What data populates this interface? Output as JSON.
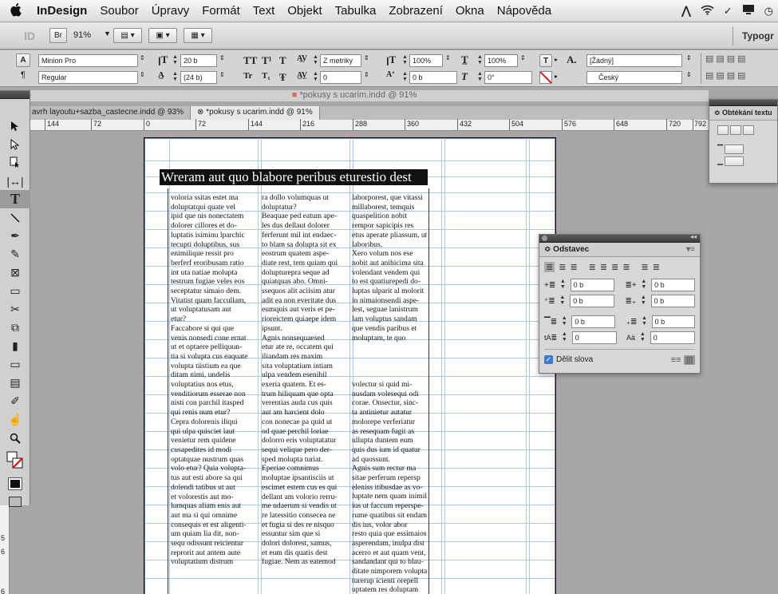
{
  "menubar": {
    "app_name": "InDesign",
    "items": [
      "Soubor",
      "Úpravy",
      "Formát",
      "Text",
      "Objekt",
      "Tabulka",
      "Zobrazení",
      "Okna",
      "Nápověda"
    ]
  },
  "appbar": {
    "id_logo": "ID",
    "br_button": "Br",
    "zoom": "91%",
    "workspace": "Typogr"
  },
  "control": {
    "font_family": "Minion Pro",
    "font_style": "Regular",
    "font_size": "20 b",
    "leading": "(24 b)",
    "kerning": "Z metriky",
    "tracking": "0",
    "vscale": "100%",
    "hscale": "100%",
    "baseline": "0 b",
    "skew": "0°",
    "char_style": "[Žádný]",
    "language": "Český",
    "glyphs_tt": "TT",
    "glyphs_t1": "T¹",
    "glyphs_tr": "Tr",
    "glyphs_t2": "T₁"
  },
  "window": {
    "title": "*pokusy s ucarim.indd @ 91%"
  },
  "tabs": [
    {
      "label": "avrh layoutu+sazba_castecne.indd @ 93%"
    },
    {
      "label": "*pokusy s ucarim.indd @ 91%"
    }
  ],
  "ruler": {
    "ticks": [
      "144",
      "72",
      "0",
      "72",
      "144",
      "216",
      "288",
      "360",
      "432",
      "504",
      "576",
      "648",
      "720",
      "792"
    ],
    "vticks": [
      "4",
      "5",
      "6",
      "6"
    ]
  },
  "document": {
    "heading": "Wreram aut quo blabore peribus eturestio dest",
    "col1": [
      "voloria ssitas estet ma",
      "doluptatqui quate vel",
      "ipid que nis nonectatem",
      "dolorer cillores et do-",
      "luptatis isiminu lparchic",
      "tecupti doluptibus, sus",
      "enimilique ressit pro",
      "berferf eroribusam ratio",
      "int uta natiae molupta",
      "testrum fugiae veles eos",
      "seceptatur simaio dem.",
      "Vitatist quam faccullam,",
      "ut voluptatusam aut",
      "etur?",
      "Faccabore si qui que",
      "venis nonsedi cone ernat",
      "ut et optaere pelliquun-",
      "tia si volupta cus eaquate",
      "volupta tiistium ea que",
      "ditam nimi, undelis",
      "voluptatius nos etus,",
      "venditiorum esserae non",
      "nisti con parchil itasped",
      "qui renis num etur?",
      "Cepra dolorenis iliqui",
      "qui ulpa quisciet laut",
      "venietur rem quidene",
      "cusapedites id modi",
      "optatquae nustrum quas",
      "volo etur? Quia volupta-",
      "tus aut esti abore sa qui",
      "dolendi tatibus ut aut",
      "et volorestis aut mo-",
      "lumquas aliam enis aut",
      "aut ma si qui omnime",
      "consequis et est aligenti-",
      "um quiam lia dit, non-",
      "sequ odissunt reicientur",
      "reprorit aut antem aute",
      "voluptatium distrum"
    ],
    "col2": [
      "ra dollo volumquas ut",
      "doluptatur?",
      "Beaquae ped eatum ape-",
      "les dus dellaut dolorer",
      "ferferunt mil int endaec-",
      "to blam sa dolupta sit ex",
      "eostrum quatem aspe-",
      "diate rest, tem quiam qui",
      "dolupturepra seque ad",
      "quiatquas abo. Omni-",
      "ssequos alit aciisim atur",
      "adit ea non everitate dus",
      "eumquis aut veris et pe-",
      "rioreictem quiaepe idem",
      "ipsunt.",
      "Agnis nonsequaesed",
      "etur ate re, occatem qui",
      "iliandam res maxim",
      "sita voluptatium intiam",
      "ulpa vendem esenihil",
      "exeria quatem. Et es-",
      "trum hiliquam que opta",
      "verentias auda cus quis",
      "aut am harcient dolo",
      "con nonecae pa quid ut",
      "od quae perchil loriae",
      "dolorro eris voluptatatur",
      "sequi velique pero der-",
      "sped molupta turiat.",
      "Eperiae comnimus",
      "moluptae ipsantisciis ut",
      "escimet estem cus es qui",
      "dellant am volorio rerru-",
      "me ndaerum si vendis ut",
      "re latessitio consecea ne",
      "et fugia si des re nisquo",
      "essuntur sim que si",
      "dolori dolorest, samus,",
      "et eum dis quatis dest",
      "fugiae. Nem as eatemod"
    ],
    "col3a": [
      "laborporest, que vitassi",
      "millaborest, temquis",
      "quaspelition nobit",
      "rempor sapicipis res",
      "etus aperate pliassum, ut",
      "laboribus.",
      "Xero volum nos ese",
      "nobit aut anihicima sita",
      "volendant vendem qui",
      "to est quatiurepedi do-",
      "luptas ulparit al molorit",
      "in nimaionsendi aspe-",
      "lest, seguae lanistrum",
      "lam voluptus sandam",
      "que vendis paribus et",
      "moluptam, te quo"
    ],
    "col3b": [
      "volectur si quid mi-",
      "nusdam volesequi odi",
      "corae. Onsectur, sinc-",
      "ta antinietur autatur",
      "molorepe verferiatur",
      "as resequam fugit as",
      "ullupta duntem eum",
      "quis dus ium id quatur",
      "ad quossunt.",
      "Agnis sum rectur ma",
      "sitae perferum repersp",
      "eleniss itibusdae as vo-",
      "luptate nem quam inimil",
      "ius ut faccum reperspe-",
      "rume quatibus sit endam",
      "dis ius, volor abor",
      "resto quia que essimaios",
      "asperendam, inulpa dist",
      "acerro et aut quam vent,",
      "sandandant qui to blau-",
      "ditate nimporem volupta",
      "turerup icienti orepell",
      "uptatem res doluptam"
    ]
  },
  "panel_wrap": {
    "title": "Obtékání textu"
  },
  "panel_para": {
    "title": "Odstavec",
    "left_indent": "0 b",
    "right_indent": "0 b",
    "first_indent": "0 b",
    "last_indent": "0 b",
    "space_before": "0 b",
    "space_after": "0 b",
    "dropcap_lines": "0",
    "dropcap_chars": "0",
    "hyphenate_label": "Dělit slova"
  }
}
